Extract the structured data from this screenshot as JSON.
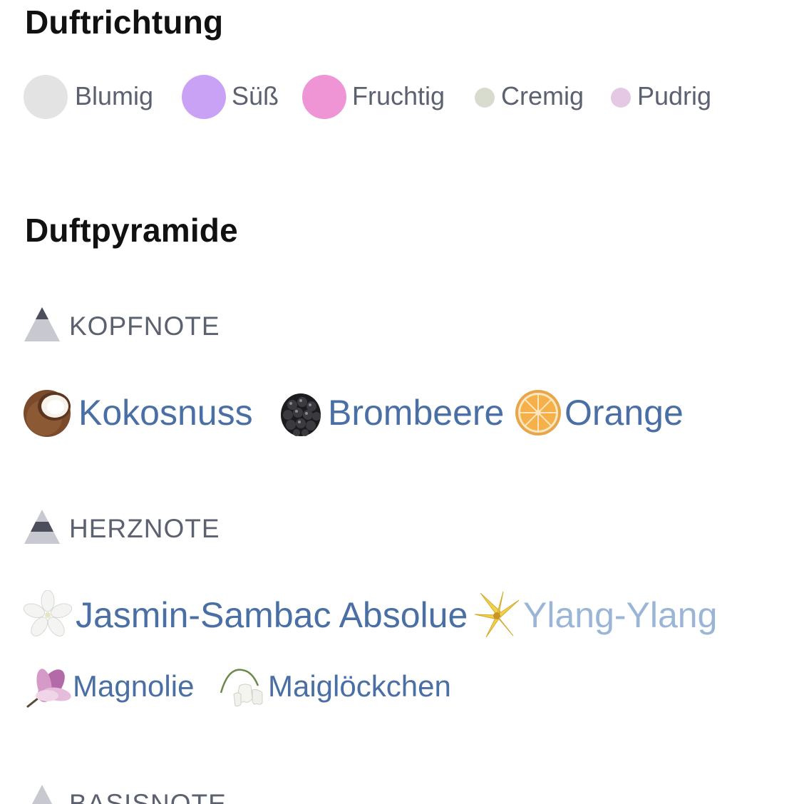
{
  "headings": {
    "direction": "Duftrichtung",
    "pyramid": "Duftpyramide"
  },
  "direction_items": [
    {
      "label": "Blumig",
      "color": "#e3e3e3"
    },
    {
      "label": "Süß",
      "color": "#c9a2f5"
    },
    {
      "label": "Fruchtig",
      "color": "#ef95d6"
    },
    {
      "label": "Cremig",
      "color": "#d8dccf"
    },
    {
      "label": "Pudrig",
      "color": "#e5c8e3"
    }
  ],
  "notes": {
    "top": {
      "label": "KOPFNOTE",
      "ingredients": [
        {
          "label": "Kokosnuss",
          "icon": "coconut-icon"
        },
        {
          "label": "Brombeere",
          "icon": "blackberry-icon"
        },
        {
          "label": "Orange",
          "icon": "orange-slice-icon"
        }
      ]
    },
    "heart": {
      "label": "HERZNOTE",
      "ingredients": [
        {
          "label": "Jasmin-Sambac Absolue",
          "icon": "jasmine-icon"
        },
        {
          "label": "Ylang-Ylang",
          "icon": "ylang-ylang-icon"
        },
        {
          "label": "Magnolie",
          "icon": "magnolia-icon"
        },
        {
          "label": "Maiglöckchen",
          "icon": "lily-of-the-valley-icon"
        }
      ]
    },
    "base": {
      "label": "BASISNOTE"
    }
  },
  "colors": {
    "link": "#4a6fa5",
    "link_light": "#9bb5d6",
    "muted_text": "#5c6170",
    "heading": "#111111"
  }
}
